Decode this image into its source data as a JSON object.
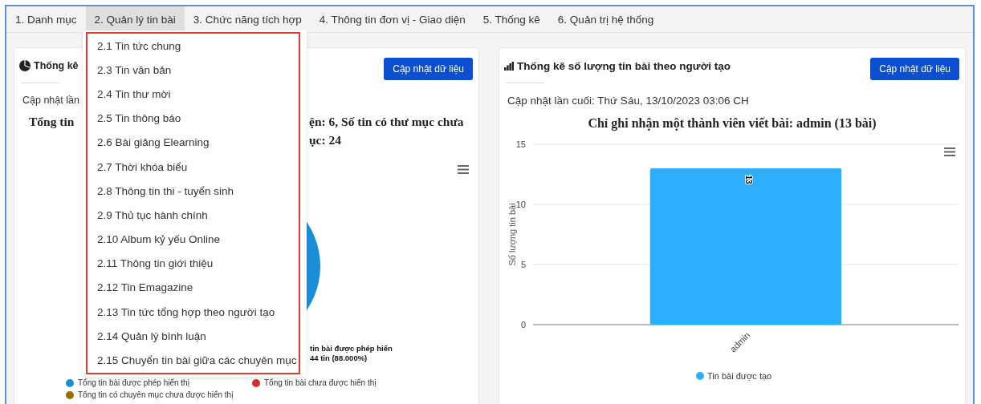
{
  "tabs": [
    {
      "label": "1. Danh mục",
      "selected": false
    },
    {
      "label": "2. Quản lý tin bài",
      "selected": true
    },
    {
      "label": "3. Chức năng tích hợp",
      "selected": false
    },
    {
      "label": "4. Thông tin đơn vị - Giao diện",
      "selected": false
    },
    {
      "label": "5. Thống kê",
      "selected": false
    },
    {
      "label": "6. Quản trị hệ thống",
      "selected": false
    }
  ],
  "dropdown": {
    "items": [
      "2.1 Tin tức chung",
      "2.3 Tin văn bản",
      "2.4 Tin thư mời",
      "2.5 Tin thông báo",
      "2.6 Bài giảng Elearning",
      "2.7 Thời khóa biểu",
      "2.8 Thông tin thi - tuyển sinh",
      "2.9 Thủ tục hành chính",
      "2.10 Album kỷ yếu Online",
      "2.11 Thông tin giới thiệu",
      "2.12 Tin Emagazine",
      "2.13 Tin tức tổng hợp theo người tạo",
      "2.14 Quản lý bình luận",
      "2.15 Chuyển tin bài giữa các chuyên mục"
    ]
  },
  "category_panel": {
    "title": "Thống kê",
    "button": "Cập nhật dữ liệu",
    "updated": "Cập nhật lần",
    "chart_title_left": "Tổng tin",
    "chart_title_right": [
      "ện: 6, Số tin có thư mục chưa",
      "ục: 24"
    ],
    "data_label": [
      "tin bài được phép hiển",
      "44 tin (88.000%)"
    ],
    "legend": [
      {
        "label": "Tổng tin bài được phép hiển thị",
        "color": "#1a8fd8"
      },
      {
        "label": "Tổng tin bài chưa được hiển thị",
        "color": "#d32f2f"
      },
      {
        "label": "Tổng tin có chuyên mục chưa được hiển thị",
        "color": "#9c6b00"
      }
    ]
  },
  "author_panel": {
    "title": "Thống kê số lượng tin bài theo người tạo",
    "button": "Cập nhật dữ liệu",
    "updated": "Cập nhật lần cuối: Thứ Sáu, 13/10/2023 03:06 CH",
    "chart_data": {
      "type": "bar",
      "title": "Chỉ ghi nhận một thành viên viết bài: admin (13 bài)",
      "ylabel": "Số lượng tin bài",
      "categories": [
        "admin"
      ],
      "series": [
        {
          "name": "Tin bài được tạo",
          "color": "#2caffe",
          "values": [
            13
          ]
        }
      ],
      "ylim": [
        0,
        15
      ],
      "yticks": [
        0,
        5,
        10,
        15
      ],
      "data_labels": true
    }
  }
}
